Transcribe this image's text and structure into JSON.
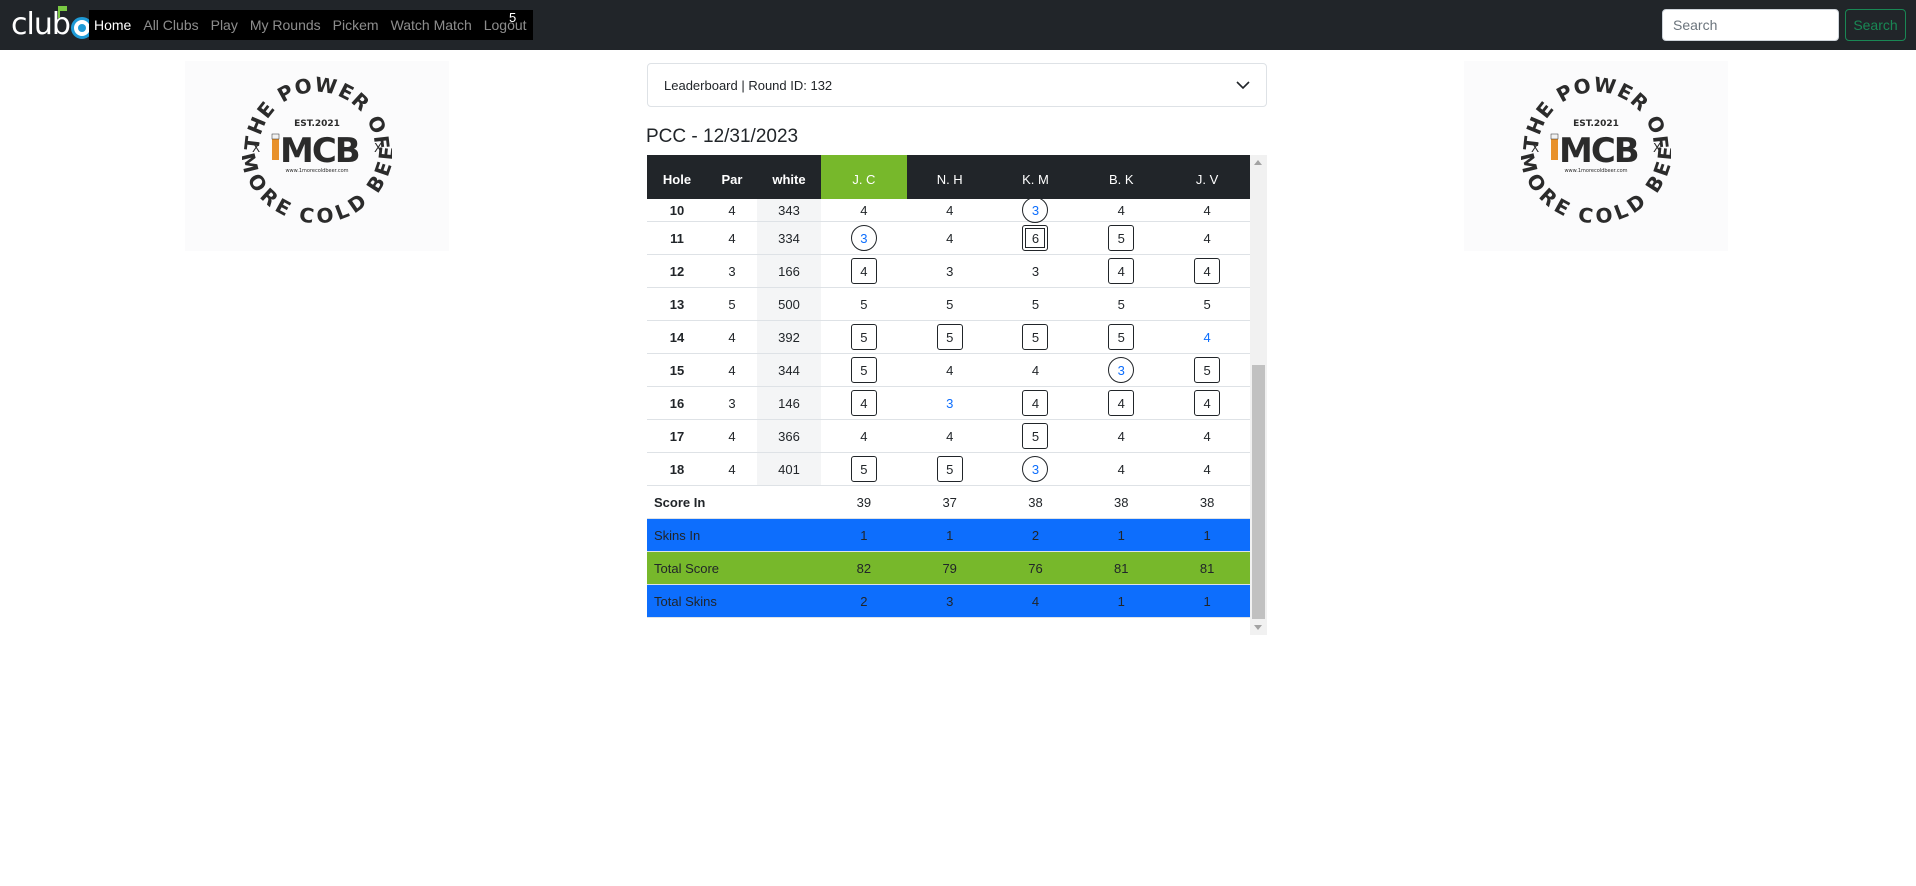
{
  "navbar": {
    "brand": "club",
    "links": [
      "Home",
      "All Clubs",
      "Play",
      "My Rounds",
      "Pickem",
      "Watch Match",
      "Logout"
    ],
    "badge": "5",
    "search_placeholder": "Search",
    "search_button": "Search"
  },
  "logo": {
    "ring_top": "THE POWER OF",
    "ring_bottom": "1 MORE COLD BEER",
    "est": "EST.2021",
    "mark": "MCB",
    "url": "www.1morecoldbeer.com"
  },
  "accordion_label": "Leaderboard | Round ID: 132",
  "course_title": "PCC - 12/31/2023",
  "table": {
    "headers": [
      "Hole",
      "Par",
      "white"
    ],
    "players": [
      "J. C",
      "N. H",
      "K. M",
      "B. K",
      "J. V"
    ],
    "leader_index": 0,
    "rows": [
      {
        "hole": "10",
        "par": "4",
        "yards": "343",
        "scores": [
          {
            "v": "4",
            "t": "par"
          },
          {
            "v": "4",
            "t": "par"
          },
          {
            "v": "3",
            "t": "birdie"
          },
          {
            "v": "4",
            "t": "par"
          },
          {
            "v": "4",
            "t": "par"
          }
        ]
      },
      {
        "hole": "11",
        "par": "4",
        "yards": "334",
        "scores": [
          {
            "v": "3",
            "t": "birdie"
          },
          {
            "v": "4",
            "t": "par"
          },
          {
            "v": "6",
            "t": "double"
          },
          {
            "v": "5",
            "t": "bogey"
          },
          {
            "v": "4",
            "t": "par"
          }
        ]
      },
      {
        "hole": "12",
        "par": "3",
        "yards": "166",
        "scores": [
          {
            "v": "4",
            "t": "bogey"
          },
          {
            "v": "3",
            "t": "par"
          },
          {
            "v": "3",
            "t": "par"
          },
          {
            "v": "4",
            "t": "bogey"
          },
          {
            "v": "4",
            "t": "bogey"
          }
        ]
      },
      {
        "hole": "13",
        "par": "5",
        "yards": "500",
        "scores": [
          {
            "v": "5",
            "t": "par"
          },
          {
            "v": "5",
            "t": "par"
          },
          {
            "v": "5",
            "t": "par"
          },
          {
            "v": "5",
            "t": "par"
          },
          {
            "v": "5",
            "t": "par"
          }
        ]
      },
      {
        "hole": "14",
        "par": "4",
        "yards": "392",
        "scores": [
          {
            "v": "5",
            "t": "bogey"
          },
          {
            "v": "5",
            "t": "bogey"
          },
          {
            "v": "5",
            "t": "bogey"
          },
          {
            "v": "5",
            "t": "bogey"
          },
          {
            "v": "4",
            "t": "skin"
          }
        ]
      },
      {
        "hole": "15",
        "par": "4",
        "yards": "344",
        "scores": [
          {
            "v": "5",
            "t": "bogey"
          },
          {
            "v": "4",
            "t": "par"
          },
          {
            "v": "4",
            "t": "par"
          },
          {
            "v": "3",
            "t": "birdie"
          },
          {
            "v": "5",
            "t": "bogey"
          }
        ]
      },
      {
        "hole": "16",
        "par": "3",
        "yards": "146",
        "scores": [
          {
            "v": "4",
            "t": "bogey"
          },
          {
            "v": "3",
            "t": "skin"
          },
          {
            "v": "4",
            "t": "bogey"
          },
          {
            "v": "4",
            "t": "bogey"
          },
          {
            "v": "4",
            "t": "bogey"
          }
        ]
      },
      {
        "hole": "17",
        "par": "4",
        "yards": "366",
        "scores": [
          {
            "v": "4",
            "t": "par"
          },
          {
            "v": "4",
            "t": "par"
          },
          {
            "v": "5",
            "t": "bogey"
          },
          {
            "v": "4",
            "t": "par"
          },
          {
            "v": "4",
            "t": "par"
          }
        ]
      },
      {
        "hole": "18",
        "par": "4",
        "yards": "401",
        "scores": [
          {
            "v": "5",
            "t": "bogey"
          },
          {
            "v": "5",
            "t": "bogey"
          },
          {
            "v": "3",
            "t": "birdie"
          },
          {
            "v": "4",
            "t": "par"
          },
          {
            "v": "4",
            "t": "par"
          }
        ]
      }
    ],
    "summary": [
      {
        "label": "Score In",
        "style": "plain",
        "values": [
          "39",
          "37",
          "38",
          "38",
          "38"
        ]
      },
      {
        "label": "Skins In",
        "style": "blue",
        "values": [
          "1",
          "1",
          "2",
          "1",
          "1"
        ]
      },
      {
        "label": "Total Score",
        "style": "green",
        "values": [
          "82",
          "79",
          "76",
          "81",
          "81"
        ]
      },
      {
        "label": "Total Skins",
        "style": "blue",
        "values": [
          "2",
          "3",
          "4",
          "1",
          "1"
        ]
      }
    ]
  },
  "colors": {
    "navbar": "#212529",
    "leader": "#77b82b",
    "skins_blue": "#0d6efd",
    "search_green": "#198754"
  }
}
